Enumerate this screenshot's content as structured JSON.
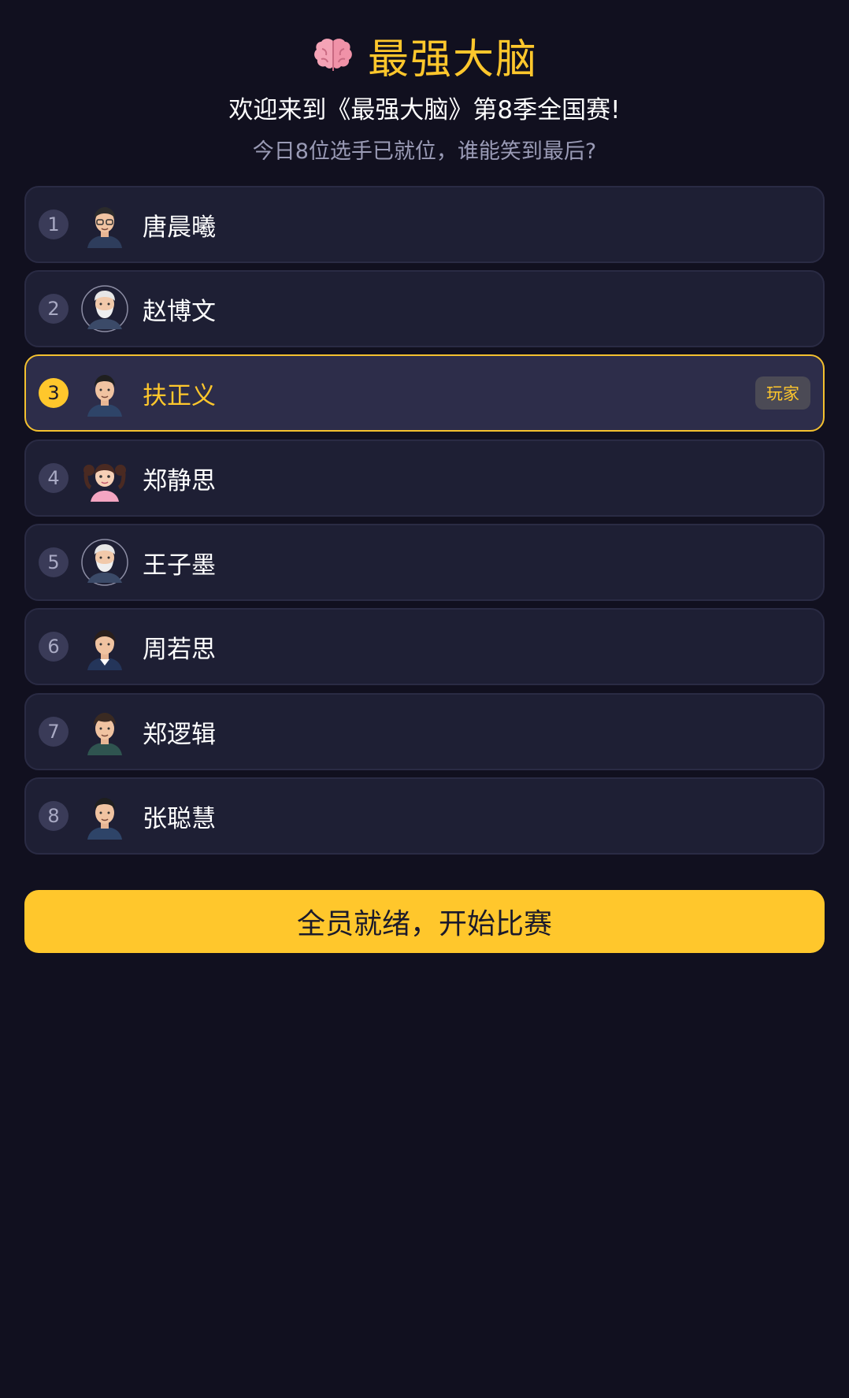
{
  "header": {
    "icon": "brain-icon",
    "title": "最强大脑",
    "subtitle": "欢迎来到《最强大脑》第8季全国赛!",
    "tagline": "今日8位选手已就位，谁能笑到最后?"
  },
  "players": [
    {
      "rank": "1",
      "name": "唐晨曦",
      "avatar": "man-glasses-avatar"
    },
    {
      "rank": "2",
      "name": "赵博文",
      "avatar": "old-man-beard-avatar"
    },
    {
      "rank": "3",
      "name": "扶正义",
      "avatar": "young-man-avatar",
      "badge": "玩家",
      "selected": true
    },
    {
      "rank": "4",
      "name": "郑静思",
      "avatar": "girl-pigtails-avatar"
    },
    {
      "rank": "5",
      "name": "王子墨",
      "avatar": "old-man-beard-avatar"
    },
    {
      "rank": "6",
      "name": "周若思",
      "avatar": "young-woman-avatar"
    },
    {
      "rank": "7",
      "name": "郑逻辑",
      "avatar": "young-man-green-avatar"
    },
    {
      "rank": "8",
      "name": "张聪慧",
      "avatar": "young-man-avatar"
    }
  ],
  "start_button": {
    "label": "全员就绪，开始比赛"
  },
  "colors": {
    "background": "#11101f",
    "card": "#1e1f34",
    "accent": "#ffc72c"
  }
}
